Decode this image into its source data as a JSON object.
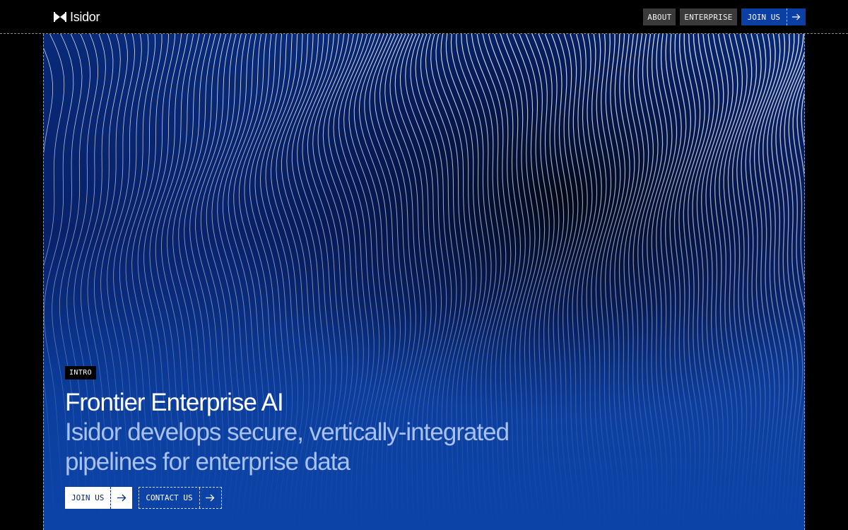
{
  "brand": {
    "name": "Isidor",
    "logo_icon": "bowtie-logo-icon"
  },
  "nav": {
    "items": [
      {
        "label": "ABOUT"
      },
      {
        "label": "ENTERPRISE"
      }
    ],
    "cta_label": "JOIN US",
    "cta_icon": "arrow-right-icon"
  },
  "hero": {
    "badge": "INTRO",
    "headline": "Frontier Enterprise AI",
    "subhead_line1": "Isidor develops secure, vertically-integrated",
    "subhead_line2": "pipelines for enterprise data",
    "primary_cta": "JOIN US",
    "secondary_cta": "CONTACT US",
    "cta_icon": "arrow-right-icon",
    "background_art": "flowing-lines-pattern"
  },
  "colors": {
    "page_bg": "#000000",
    "accent_blue": "#0b3fa6",
    "hero_bg": "#0c43a6",
    "subhead_text": "#a9c1ee",
    "nav_button_bg": "#3a3a3a"
  }
}
